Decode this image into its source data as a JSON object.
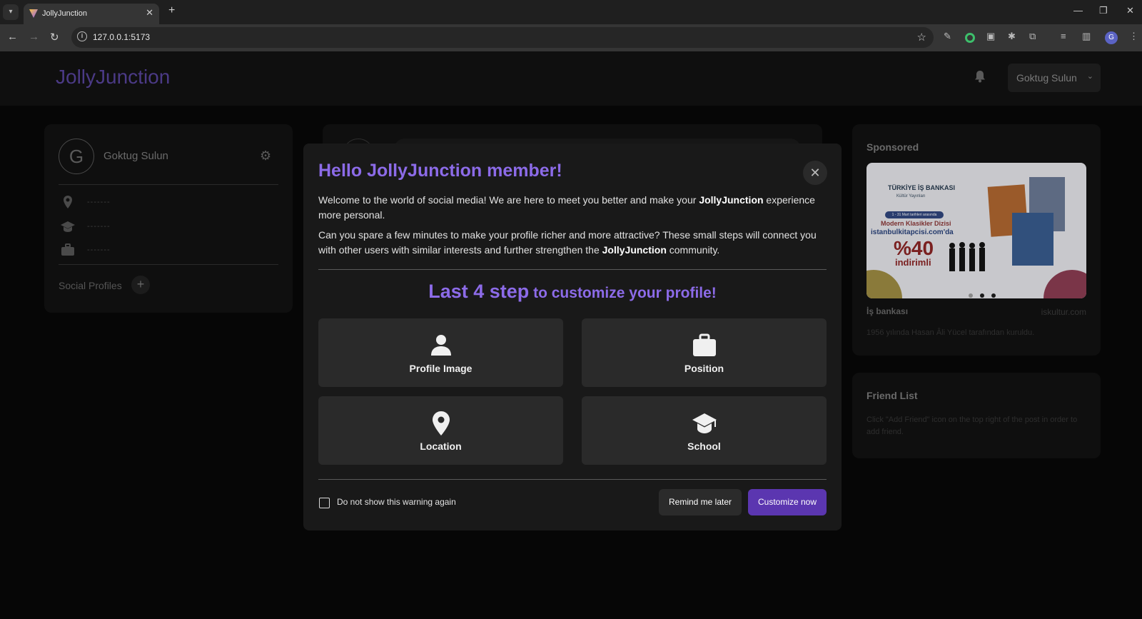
{
  "browser": {
    "tab_title": "JollyJunction",
    "url": "127.0.0.1:5173",
    "profile_initial": "G"
  },
  "header": {
    "brand": "JollyJunction",
    "user_name": "Goktug Sulun"
  },
  "profile_card": {
    "initial": "G",
    "name": "Goktug Sulun",
    "location": "-------",
    "school": "-------",
    "position": "-------",
    "social_profiles_label": "Social Profiles",
    "add_symbol": "+"
  },
  "sponsored": {
    "heading": "Sponsored",
    "ad_title": "İş bankası",
    "ad_domain": "iskultur.com",
    "ad_description": "1956 yılında Hasan Âli Yücel tarafından kuruldu.",
    "banner": {
      "brand": "TÜRKİYE İŞ BANKASI",
      "brand_sub": "Kültür Yayınları",
      "pill": "1 - 31 Mart tarihleri arasında",
      "line1": "Modern Klasikler Dizisi",
      "line2": "istanbulkitapcisi.com'da",
      "percent": "%40",
      "discount": "indirimli"
    }
  },
  "friend_list": {
    "heading": "Friend List",
    "empty_text": "Click \"Add Friend\" icon on the top right of the post in order to add friend."
  },
  "modal": {
    "title": "Hello JollyJunction member!",
    "close_symbol": "✕",
    "para1_before": " Welcome to the world of social media! We are here to meet you better and make your ",
    "para1_bold": "JollyJunction",
    "para1_after": " experience more personal.",
    "para2_before": " Can you spare a few minutes to make your profile richer and more attractive? These small steps will connect you with other users with similar interests and further strengthen the ",
    "para2_bold": "JollyJunction",
    "para2_after": " community.",
    "steps_heading_big": "Last 4 step",
    "steps_heading_rest": " to customize your profile!",
    "steps": [
      {
        "label": "Profile Image",
        "icon": "user-icon"
      },
      {
        "label": "Position",
        "icon": "briefcase-icon"
      },
      {
        "label": "Location",
        "icon": "location-pin-icon"
      },
      {
        "label": "School",
        "icon": "graduation-cap-icon"
      }
    ],
    "checkbox_label": "Do not show this warning again",
    "remind_label": "Remind me later",
    "customize_label": "Customize now"
  },
  "colors": {
    "accent": "#8c6be8",
    "primary_button": "#5b36b0",
    "brand_dim": "#4b3a86"
  }
}
